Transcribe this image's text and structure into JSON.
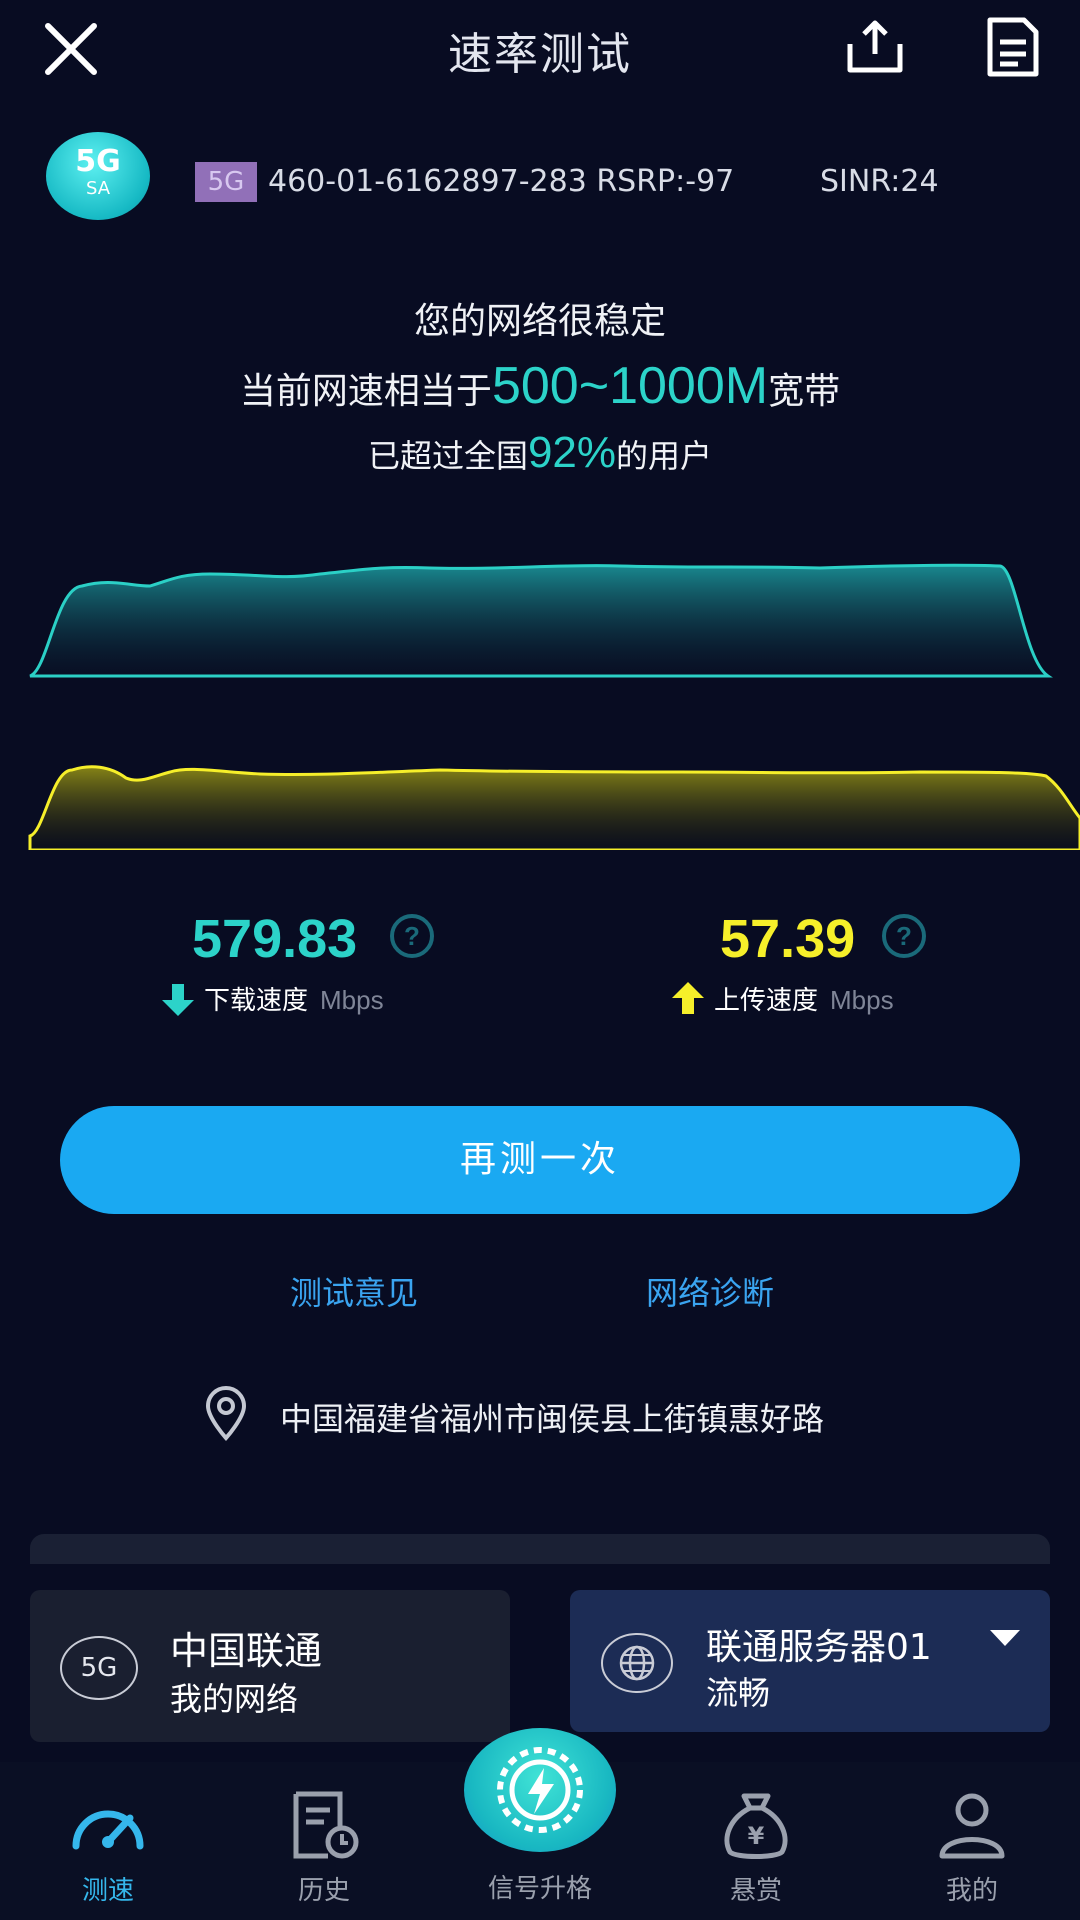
{
  "header": {
    "title": "速率测试",
    "close_icon": "close-icon",
    "share_icon": "share-icon",
    "report_icon": "report-icon"
  },
  "network": {
    "badge_main": "5G",
    "badge_sub": "SA",
    "tag": "5G",
    "cell_info": "460-01-6162897-283 RSRP:-97",
    "sinr": "SINR:24"
  },
  "summary": {
    "stable_text": "您的网络很稳定",
    "equiv_prefix": "当前网速相当于",
    "equiv_value": "500~1000M",
    "equiv_suffix": "宽带",
    "exceed_prefix": "已超过全国",
    "exceed_value": "92%",
    "exceed_suffix": "的用户"
  },
  "speeds": {
    "download_value": "579.83",
    "download_label": "下载速度",
    "upload_value": "57.39",
    "upload_label": "上传速度",
    "unit": "Mbps",
    "download_color": "#2cd3c9",
    "upload_color": "#f6ef2a"
  },
  "actions": {
    "retest_label": "再测一次",
    "feedback_label": "测试意见",
    "diagnose_label": "网络诊断"
  },
  "location": {
    "text": "中国福建省福州市闽侯县上街镇惠好路",
    "icon": "location-pin-icon"
  },
  "operator": {
    "badge": "5G",
    "name": "中国联通",
    "sub": "我的网络"
  },
  "server": {
    "name": "联通服务器01",
    "status": "流畅",
    "icon": "globe-icon"
  },
  "nav": {
    "speed": "测速",
    "history": "历史",
    "upgrade": "信号升格",
    "reward": "悬赏",
    "mine": "我的"
  },
  "colors": {
    "accent": "#1aa9f2",
    "background": "#080c22",
    "link": "#3aa4f0"
  }
}
